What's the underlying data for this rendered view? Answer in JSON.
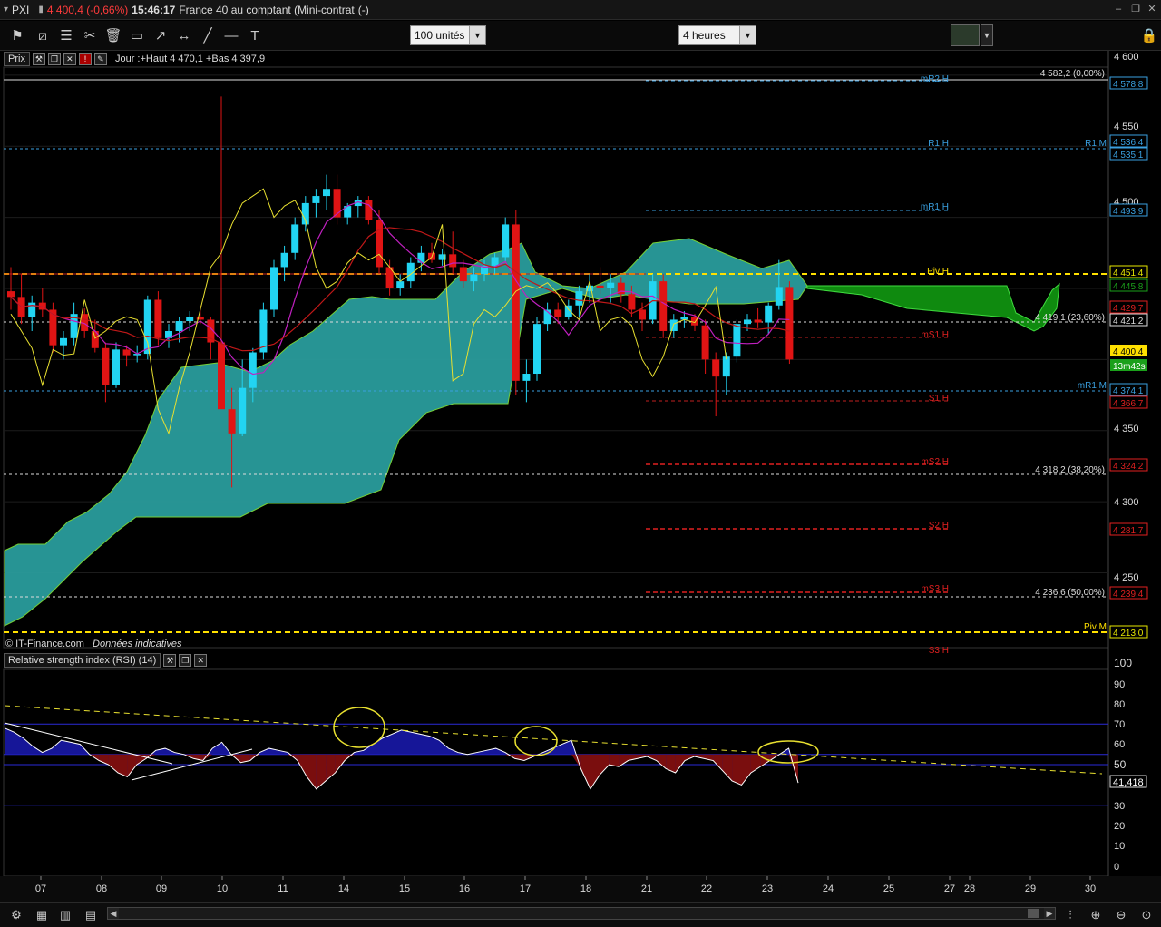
{
  "title_bar": {
    "symbol": "PXI",
    "quote": "4 400,4 (-0,66%)",
    "time": "15:46:17",
    "name": "France 40 au comptant (Mini-contrat",
    "suffix": "(-)"
  },
  "toolbar": {
    "quantity": "100 unités",
    "timeframe": "4 heures",
    "icons": [
      "alert-icon",
      "draw-trend-icon",
      "fibonacci-icon",
      "tools-icon",
      "delete-icon",
      "rectangle-icon",
      "arrow-icon",
      "ray-icon",
      "line-icon",
      "hline-icon",
      "text-icon"
    ]
  },
  "price_panel": {
    "label": "Prix",
    "day_info": "Jour :+Haut 4 470,1 +Bas 4 397,9",
    "credit": "© IT-Finance.com",
    "credit_note": "Données indicatives",
    "axis_ticks": [
      "4 600",
      "4 550",
      "4 500",
      "4 350",
      "4 300",
      "4 250"
    ],
    "pivot_labels": [
      "mR2 H",
      "R1 H",
      "mR1 H",
      "Piv H",
      "mS1 H",
      "S1 H",
      "mS2 H",
      "S2 H",
      "mS3 H",
      "S3 H"
    ],
    "right_labels": [
      "R1 M",
      "mR1 M",
      "Piv M"
    ],
    "fib_labels": [
      "4 582,2 (0,00%)",
      "4 419,1 (23,60%)",
      "4 318,2 (38,20%)",
      "4 236,6 (50,00%)"
    ],
    "price_tags": [
      {
        "text": "4 578,8",
        "color": "#3aa0e0"
      },
      {
        "text": "4 536,4",
        "color": "#3aa0e0"
      },
      {
        "text": "4 535,1",
        "color": "#3aa0e0"
      },
      {
        "text": "4 493,9",
        "color": "#3aa0e0"
      },
      {
        "text": "4 451,4",
        "color": "#e8e800"
      },
      {
        "text": "4 445,8",
        "color": "#1aa01a"
      },
      {
        "text": "4 429,7",
        "color": "#e02020"
      },
      {
        "text": "4 421,2",
        "color": "#dddddd"
      },
      {
        "text": "4 400,4",
        "color": "#ffe000"
      },
      {
        "text": "13m42s",
        "color": "#1aa01a"
      },
      {
        "text": "4 374,1",
        "color": "#3aa0e0"
      },
      {
        "text": "4 366,7",
        "color": "#e02020"
      },
      {
        "text": "4 324,2",
        "color": "#e02020"
      },
      {
        "text": "4 281,7",
        "color": "#e02020"
      },
      {
        "text": "4 239,4",
        "color": "#e02020"
      },
      {
        "text": "4 213,0",
        "color": "#e8e800"
      }
    ]
  },
  "rsi_panel": {
    "label": "Relative strength index (RSI) (14)",
    "axis_ticks": [
      "100",
      "90",
      "80",
      "70",
      "60",
      "50",
      "30",
      "20",
      "10",
      "0"
    ],
    "value_tag": "41,418"
  },
  "x_axis": {
    "dates": [
      "07",
      "08",
      "09",
      "10",
      "11",
      "14",
      "15",
      "16",
      "17",
      "18",
      "21",
      "22",
      "23",
      "24",
      "25",
      "27",
      "28",
      "29",
      "30"
    ]
  },
  "chart_data": {
    "type": "candlestick",
    "instrument": "France 40 au comptant (Mini-contrat",
    "timeframe": "4 heures",
    "ylim": [
      4205,
      4605
    ],
    "candles": [
      {
        "o": 4448,
        "h": 4465,
        "l": 4435,
        "c": 4444
      },
      {
        "o": 4444,
        "h": 4460,
        "l": 4425,
        "c": 4430
      },
      {
        "o": 4430,
        "h": 4445,
        "l": 4420,
        "c": 4440
      },
      {
        "o": 4440,
        "h": 4450,
        "l": 4430,
        "c": 4435
      },
      {
        "o": 4435,
        "h": 4440,
        "l": 4405,
        "c": 4410
      },
      {
        "o": 4410,
        "h": 4420,
        "l": 4400,
        "c": 4415
      },
      {
        "o": 4415,
        "h": 4440,
        "l": 4410,
        "c": 4432
      },
      {
        "o": 4432,
        "h": 4436,
        "l": 4415,
        "c": 4420
      },
      {
        "o": 4420,
        "h": 4428,
        "l": 4405,
        "c": 4408
      },
      {
        "o": 4408,
        "h": 4412,
        "l": 4370,
        "c": 4382
      },
      {
        "o": 4382,
        "h": 4412,
        "l": 4380,
        "c": 4407
      },
      {
        "o": 4407,
        "h": 4410,
        "l": 4395,
        "c": 4403
      },
      {
        "o": 4403,
        "h": 4410,
        "l": 4398,
        "c": 4404
      },
      {
        "o": 4404,
        "h": 4445,
        "l": 4400,
        "c": 4442
      },
      {
        "o": 4442,
        "h": 4448,
        "l": 4410,
        "c": 4415
      },
      {
        "o": 4415,
        "h": 4425,
        "l": 4408,
        "c": 4420
      },
      {
        "o": 4420,
        "h": 4430,
        "l": 4412,
        "c": 4427
      },
      {
        "o": 4427,
        "h": 4434,
        "l": 4420,
        "c": 4430
      },
      {
        "o": 4430,
        "h": 4438,
        "l": 4425,
        "c": 4428
      },
      {
        "o": 4428,
        "h": 4430,
        "l": 4400,
        "c": 4412
      },
      {
        "o": 4412,
        "h": 4585,
        "l": 4385,
        "c": 4365
      },
      {
        "o": 4365,
        "h": 4380,
        "l": 4310,
        "c": 4348
      },
      {
        "o": 4348,
        "h": 4400,
        "l": 4346,
        "c": 4380
      },
      {
        "o": 4380,
        "h": 4408,
        "l": 4370,
        "c": 4405
      },
      {
        "o": 4405,
        "h": 4440,
        "l": 4400,
        "c": 4435
      },
      {
        "o": 4435,
        "h": 4470,
        "l": 4430,
        "c": 4465
      },
      {
        "o": 4465,
        "h": 4480,
        "l": 4455,
        "c": 4475
      },
      {
        "o": 4475,
        "h": 4500,
        "l": 4470,
        "c": 4495
      },
      {
        "o": 4495,
        "h": 4515,
        "l": 4490,
        "c": 4510
      },
      {
        "o": 4510,
        "h": 4520,
        "l": 4500,
        "c": 4515
      },
      {
        "o": 4515,
        "h": 4530,
        "l": 4505,
        "c": 4520
      },
      {
        "o": 4520,
        "h": 4530,
        "l": 4495,
        "c": 4500
      },
      {
        "o": 4500,
        "h": 4510,
        "l": 4495,
        "c": 4508
      },
      {
        "o": 4508,
        "h": 4515,
        "l": 4500,
        "c": 4512
      },
      {
        "o": 4512,
        "h": 4515,
        "l": 4495,
        "c": 4498
      },
      {
        "o": 4498,
        "h": 4505,
        "l": 4460,
        "c": 4465
      },
      {
        "o": 4465,
        "h": 4470,
        "l": 4445,
        "c": 4450
      },
      {
        "o": 4450,
        "h": 4460,
        "l": 4445,
        "c": 4455
      },
      {
        "o": 4455,
        "h": 4472,
        "l": 4450,
        "c": 4468
      },
      {
        "o": 4468,
        "h": 4480,
        "l": 4462,
        "c": 4475
      },
      {
        "o": 4475,
        "h": 4482,
        "l": 4468,
        "c": 4470
      },
      {
        "o": 4470,
        "h": 4478,
        "l": 4466,
        "c": 4474
      },
      {
        "o": 4474,
        "h": 4490,
        "l": 4460,
        "c": 4465
      },
      {
        "o": 4465,
        "h": 4470,
        "l": 4450,
        "c": 4455
      },
      {
        "o": 4455,
        "h": 4465,
        "l": 4448,
        "c": 4460
      },
      {
        "o": 4460,
        "h": 4470,
        "l": 4455,
        "c": 4466
      },
      {
        "o": 4466,
        "h": 4475,
        "l": 4460,
        "c": 4472
      },
      {
        "o": 4472,
        "h": 4500,
        "l": 4468,
        "c": 4495
      },
      {
        "o": 4495,
        "h": 4505,
        "l": 4375,
        "c": 4385
      },
      {
        "o": 4385,
        "h": 4400,
        "l": 4370,
        "c": 4390
      },
      {
        "o": 4390,
        "h": 4430,
        "l": 4385,
        "c": 4425
      },
      {
        "o": 4425,
        "h": 4440,
        "l": 4420,
        "c": 4435
      },
      {
        "o": 4435,
        "h": 4440,
        "l": 4425,
        "c": 4430
      },
      {
        "o": 4430,
        "h": 4442,
        "l": 4428,
        "c": 4438
      },
      {
        "o": 4438,
        "h": 4452,
        "l": 4430,
        "c": 4448
      },
      {
        "o": 4448,
        "h": 4460,
        "l": 4440,
        "c": 4452
      },
      {
        "o": 4452,
        "h": 4465,
        "l": 4446,
        "c": 4450
      },
      {
        "o": 4450,
        "h": 4460,
        "l": 4440,
        "c": 4454
      },
      {
        "o": 4454,
        "h": 4458,
        "l": 4440,
        "c": 4446
      },
      {
        "o": 4446,
        "h": 4452,
        "l": 4430,
        "c": 4435
      },
      {
        "o": 4435,
        "h": 4440,
        "l": 4420,
        "c": 4428
      },
      {
        "o": 4428,
        "h": 4460,
        "l": 4425,
        "c": 4455
      },
      {
        "o": 4455,
        "h": 4460,
        "l": 4415,
        "c": 4420
      },
      {
        "o": 4420,
        "h": 4432,
        "l": 4415,
        "c": 4428
      },
      {
        "o": 4428,
        "h": 4434,
        "l": 4422,
        "c": 4430
      },
      {
        "o": 4430,
        "h": 4432,
        "l": 4420,
        "c": 4424
      },
      {
        "o": 4424,
        "h": 4428,
        "l": 4390,
        "c": 4400
      },
      {
        "o": 4400,
        "h": 4405,
        "l": 4360,
        "c": 4388
      },
      {
        "o": 4388,
        "h": 4405,
        "l": 4375,
        "c": 4402
      },
      {
        "o": 4402,
        "h": 4428,
        "l": 4398,
        "c": 4425
      },
      {
        "o": 4425,
        "h": 4432,
        "l": 4420,
        "c": 4428
      },
      {
        "o": 4428,
        "h": 4436,
        "l": 4422,
        "c": 4426
      },
      {
        "o": 4426,
        "h": 4440,
        "l": 4418,
        "c": 4438
      },
      {
        "o": 4438,
        "h": 4470,
        "l": 4435,
        "c": 4451
      },
      {
        "o": 4451,
        "h": 4455,
        "l": 4397,
        "c": 4400
      }
    ],
    "rsi": [
      68,
      66,
      63,
      59,
      56,
      58,
      62,
      61,
      60,
      55,
      52,
      50,
      46,
      44,
      50,
      53,
      57,
      58,
      56,
      55,
      53,
      52,
      58,
      61,
      55,
      51,
      52,
      56,
      58,
      57,
      56,
      52,
      44,
      38,
      42,
      46,
      52,
      56,
      57,
      60,
      63,
      65,
      67,
      66,
      65,
      64,
      62,
      58,
      56,
      55,
      56,
      57,
      58,
      56,
      53,
      52,
      54,
      56,
      58,
      60,
      62,
      48,
      38,
      45,
      50,
      49,
      52,
      53,
      54,
      52,
      48,
      46,
      52,
      54,
      53,
      52,
      47,
      42,
      40,
      46,
      49,
      52,
      55,
      58,
      41
    ],
    "rsi_levels": [
      30,
      50,
      55,
      70
    ]
  }
}
